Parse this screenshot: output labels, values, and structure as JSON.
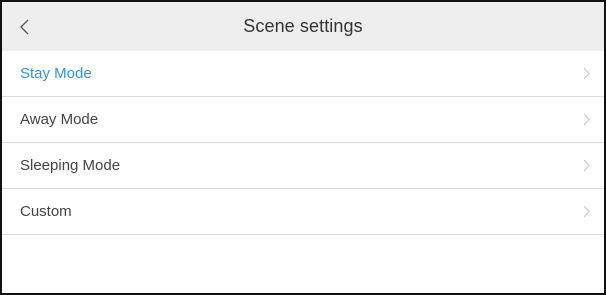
{
  "header": {
    "title": "Scene settings",
    "back_icon": "chevron-left-icon"
  },
  "scenes": [
    {
      "label": "Stay Mode",
      "active": true,
      "icon": "chevron-right-icon"
    },
    {
      "label": "Away Mode",
      "active": false,
      "icon": "chevron-right-icon"
    },
    {
      "label": "Sleeping Mode",
      "active": false,
      "icon": "chevron-right-icon"
    },
    {
      "label": "Custom",
      "active": false,
      "icon": "chevron-right-icon"
    }
  ],
  "colors": {
    "active_text": "#2f95e6",
    "header_bg": "#eeeeee",
    "divider": "#dcdcdc"
  }
}
